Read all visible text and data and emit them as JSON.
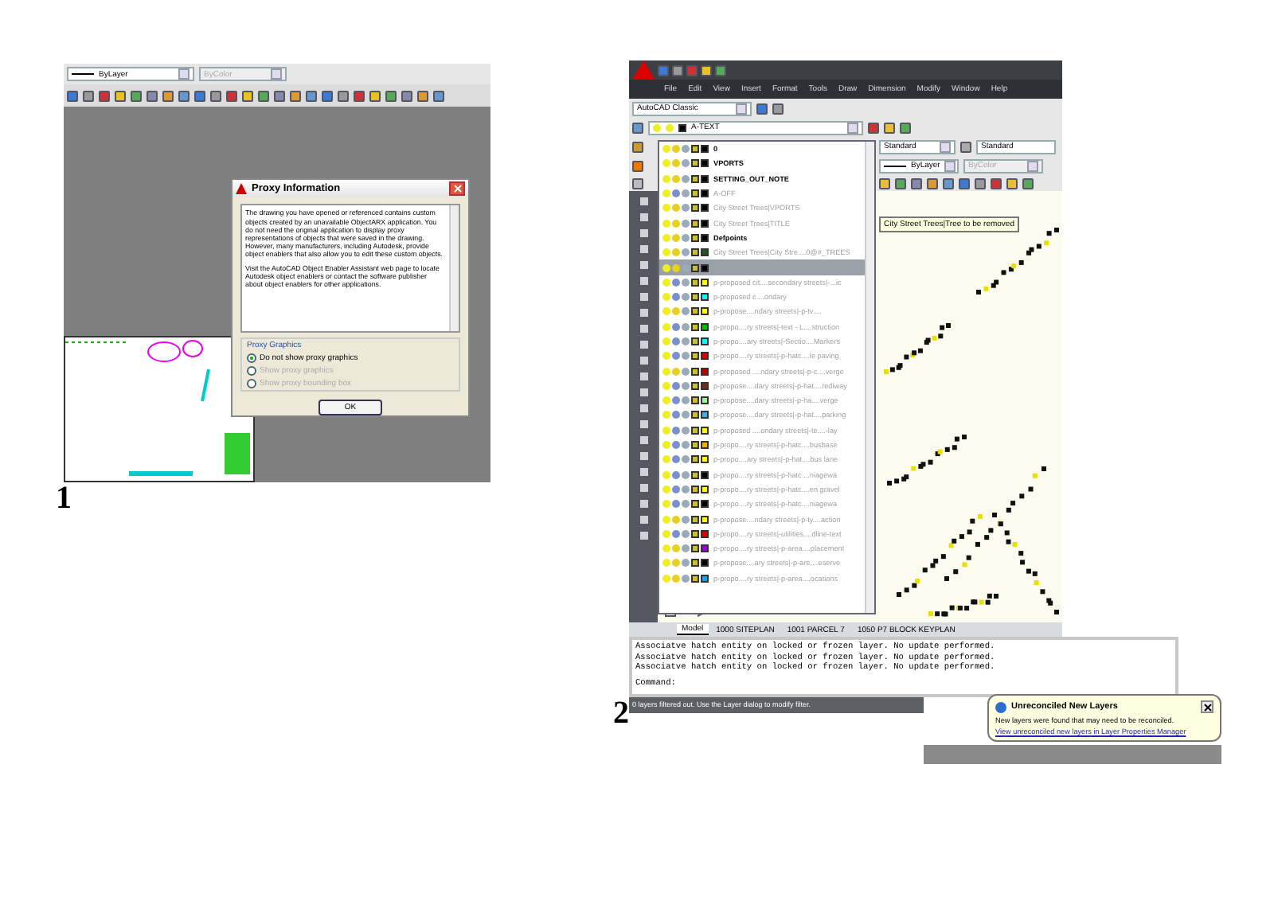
{
  "figure_1": {
    "label": "1",
    "toolbar": {
      "linetype": "ByLayer",
      "color_setting": "ByColor"
    },
    "dialog": {
      "title": "Proxy Information",
      "paragraphs": [
        "The drawing you have opened or referenced contains custom objects created by an unavailable ObjectARX application. You do not need the original application to display proxy representations of objects that were saved in the drawing. However, many manufacturers, including Autodesk, provide object enablers that also allow you to edit these custom objects.",
        "Visit the AutoCAD Object Enabler Assistant web page to locate Autodesk object enablers or contact the software publisher about object enablers for other applications."
      ],
      "group": "Proxy Graphics",
      "options": [
        {
          "label": "Do not show proxy graphics",
          "selected": true,
          "disabled": false
        },
        {
          "label": "Show proxy graphics",
          "selected": false,
          "disabled": true
        },
        {
          "label": "Show proxy bounding box",
          "selected": false,
          "disabled": true
        }
      ],
      "button": "OK"
    }
  },
  "figure_2": {
    "label": "2",
    "menu": [
      "File",
      "Edit",
      "View",
      "Insert",
      "Format",
      "Tools",
      "Draw",
      "Dimension",
      "Modify",
      "Window",
      "Help"
    ],
    "workspace": "AutoCAD Classic",
    "current_layer": "A-TEXT",
    "text_style": "Standard",
    "dim_style": "Standard",
    "linetype": "ByLayer",
    "color_setting": "ByColor",
    "layers": [
      {
        "name": "0",
        "color": "#000000",
        "greyed": false,
        "frozen": false,
        "selected": false
      },
      {
        "name": "VPORTS",
        "color": "#000000",
        "greyed": false,
        "frozen": false,
        "selected": false
      },
      {
        "name": "SETTING_OUT_NOTE",
        "color": "#000000",
        "greyed": false,
        "frozen": false,
        "selected": false
      },
      {
        "name": "A-OFF",
        "color": "#000000",
        "greyed": true,
        "frozen": true,
        "selected": false
      },
      {
        "name": "City Street Trees|VPORTS",
        "color": "#000000",
        "greyed": true,
        "frozen": false,
        "selected": false
      },
      {
        "name": "City Street Trees|TITLE",
        "color": "#000000",
        "greyed": true,
        "frozen": false,
        "selected": false
      },
      {
        "name": "Defpoints",
        "color": "#000000",
        "greyed": false,
        "frozen": false,
        "selected": false
      },
      {
        "name": "City Street Trees|City Stre....0@#_TREES",
        "color": "#1e5a1e",
        "greyed": true,
        "frozen": false,
        "selected": false
      },
      {
        "color": "#000000",
        "frozen": false,
        "selected": true
      },
      {
        "name": "p-proposed cit....secondary streets|-...ic",
        "color": "#ffff00",
        "greyed": true,
        "frozen": true,
        "selected": false
      },
      {
        "name": "p-proposed c....ondary",
        "color": "#00ffff",
        "greyed": true,
        "frozen": true,
        "selected": false
      },
      {
        "name": "p-propose....ndary streets|-p-tv....",
        "color": "#ffff00",
        "greyed": true,
        "frozen": false,
        "selected": false
      },
      {
        "name": "p-propo....ry streets|-text - L....struction",
        "color": "#00c000",
        "greyed": true,
        "frozen": true,
        "selected": false
      },
      {
        "name": "p-propo....ary streets|-Sectio....Markers",
        "color": "#00ffff",
        "greyed": true,
        "frozen": true,
        "selected": false
      },
      {
        "name": "p-propo....ry streets|-p-hatc....le paving",
        "color": "#e00000",
        "greyed": true,
        "frozen": true,
        "selected": false
      },
      {
        "name": "p-proposed ....ndary streets|-p-c....verge",
        "color": "#c00000",
        "greyed": true,
        "frozen": false,
        "selected": false
      },
      {
        "name": "p-propose....dary streets|-p-hat....rediway",
        "color": "#7a2a10",
        "greyed": true,
        "frozen": true,
        "selected": false
      },
      {
        "name": "p-propose....dary streets|-p-ha....verge",
        "color": "#a0f0a0",
        "greyed": true,
        "frozen": true,
        "selected": false
      },
      {
        "name": "p-propose....dary streets|-p-hat....parking",
        "color": "#40b0e0",
        "greyed": true,
        "frozen": true,
        "selected": false
      },
      {
        "name": "p-proposed ....ondary streets|-te....-lay",
        "color": "#ffff00",
        "greyed": true,
        "frozen": true,
        "selected": false
      },
      {
        "name": "p-propo....ry streets|-p-hatc....busbase",
        "color": "#f0b000",
        "greyed": true,
        "frozen": true,
        "selected": false
      },
      {
        "name": "p-propo....ary streets|-p-hat....bus lane",
        "color": "#ffff00",
        "greyed": true,
        "frozen": true,
        "selected": false
      },
      {
        "name": "p-propo....ry streets|-p-hatc....niagewa",
        "color": "#000000",
        "greyed": true,
        "frozen": true,
        "selected": false
      },
      {
        "name": "p-propo....ry streets|-p-hatc....en gravel",
        "color": "#ffff00",
        "greyed": true,
        "frozen": true,
        "selected": false
      },
      {
        "name": "p-propo....ry streets|-p-hatc....niagewa",
        "color": "#000000",
        "greyed": true,
        "frozen": true,
        "selected": false
      },
      {
        "name": "p-propose....ndary streets|-p-ty....action",
        "color": "#ffff00",
        "greyed": true,
        "frozen": false,
        "selected": false
      },
      {
        "name": "p-propo....ry streets|-utilities....dline-text",
        "color": "#e00000",
        "greyed": true,
        "frozen": true,
        "selected": false
      },
      {
        "name": "p-propo....ry streets|-p-area....placement",
        "color": "#a000e0",
        "greyed": true,
        "frozen": false,
        "selected": false
      },
      {
        "name": "p-propose....ary streets|-p-are....eserve",
        "color": "#000000",
        "greyed": true,
        "frozen": false,
        "selected": false
      },
      {
        "name": "p-propo....ry streets|-p-area....ocations",
        "color": "#20a0e0",
        "greyed": true,
        "frozen": false,
        "selected": false
      }
    ],
    "tooltip": "City Street Trees|Tree to be removed",
    "tabs": [
      {
        "label": "Model",
        "selected": true
      },
      {
        "label": "1000 SITEPLAN",
        "selected": false
      },
      {
        "label": "1001 PARCEL 7",
        "selected": false
      },
      {
        "label": "1050 P7 BLOCK KEYPLAN",
        "selected": false
      }
    ],
    "command_history": [
      "Associatve hatch entity on locked or frozen layer. No update performed.",
      "Associatve hatch entity on locked or frozen layer. No update performed.",
      "Associatve hatch entity on locked or frozen layer. No update performed."
    ],
    "command_prompt": "Command:",
    "status": "0 layers filtered out.  Use the Layer dialog to modify filter.",
    "balloon": {
      "title": "Unreconciled New Layers",
      "text": "New layers were found that may need to be reconciled.",
      "link": "View unreconciled new layers in Layer Properties Manager"
    }
  }
}
